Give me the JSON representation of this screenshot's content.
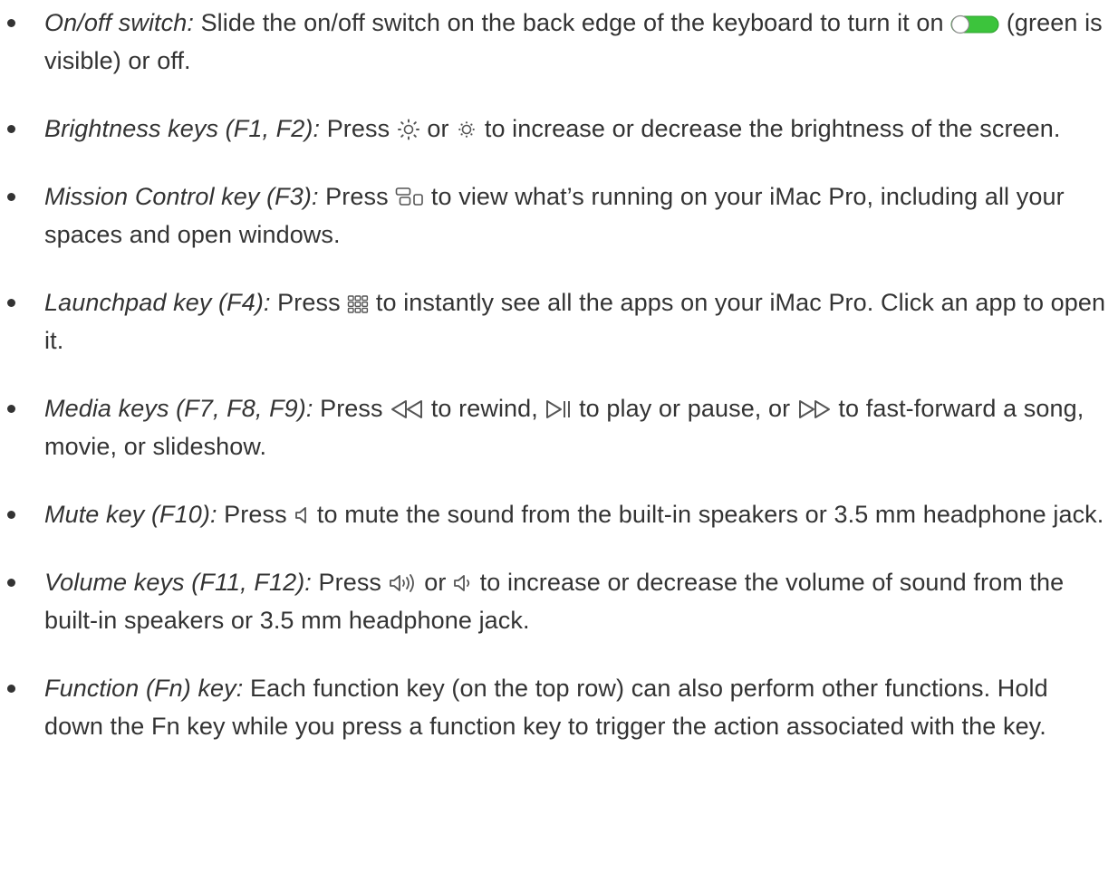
{
  "items": [
    {
      "term": "On/off switch:",
      "before": " Slide the on/off switch on the back edge of the keyboard to turn it on ",
      "icon": "toggle-switch-icon",
      "after": " (green is visible) or off."
    },
    {
      "term": "Brightness keys (F1, F2):",
      "before": " Press ",
      "icon1": "brightness-up-icon",
      "middle": " or ",
      "icon2": "brightness-down-icon",
      "after": " to increase or decrease the brightness of the screen."
    },
    {
      "term": "Mission Control key (F3):",
      "before": " Press ",
      "icon": "mission-control-icon",
      "after": " to view what’s running on your iMac Pro, including all your spaces and open windows."
    },
    {
      "term": "Launchpad key (F4):",
      "before": " Press ",
      "icon": "launchpad-icon",
      "after": " to instantly see all the apps on your iMac Pro. Click an app to open it."
    },
    {
      "term": "Media keys (F7, F8, F9):",
      "before": " Press ",
      "icon1": "rewind-icon",
      "mid1": " to rewind, ",
      "icon2": "play-pause-icon",
      "mid2": " to play or pause, or ",
      "icon3": "fast-forward-icon",
      "after": " to fast-forward a song, movie, or slideshow."
    },
    {
      "term": "Mute key (F10):",
      "before": " Press ",
      "icon": "mute-icon",
      "after": " to mute the sound from the built-in speakers or 3.5 mm headphone jack."
    },
    {
      "term": "Volume keys (F11, F12):",
      "before": " Press ",
      "icon1": "volume-up-icon",
      "middle": " or ",
      "icon2": "volume-down-icon",
      "after": " to increase or decrease the volume of sound from the built-in speakers or 3.5 mm headphone jack."
    },
    {
      "term": "Function (Fn) key:",
      "text": " Each function key (on the top row) can also perform other functions. Hold down the Fn key while you press a function key to trigger the action associated with the key."
    }
  ],
  "colors": {
    "text": "#333333",
    "toggle_on": "#3cc43c",
    "icon_stroke": "#555555"
  }
}
